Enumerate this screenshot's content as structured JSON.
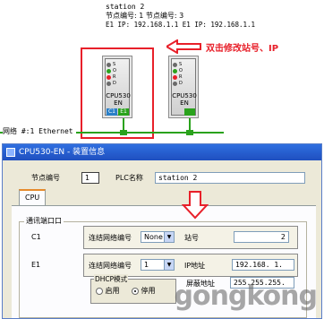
{
  "top_info": {
    "station_line": "station 2",
    "node_line": "节点编号: 1      节点编号: 3",
    "ip_line": "E1 IP: 192.168.1.1 E1 IP: 192.168.1.1"
  },
  "annotation": {
    "text": "双击修改站号、IP",
    "color": "#e8202a"
  },
  "plcs": [
    {
      "model_line1": "CPU530",
      "model_line2": "EN",
      "leds": [
        "S",
        "O",
        "R",
        "D"
      ],
      "ports": [
        "C1",
        "E1"
      ]
    },
    {
      "model_line1": "CPU530",
      "model_line2": "EN",
      "leds": [
        "S",
        "O",
        "R",
        "D"
      ],
      "ports": []
    }
  ],
  "network": {
    "label": "网络 #:1  Ethernet",
    "color": "#2aa21c"
  },
  "dialog": {
    "title": "CPU530-EN - 装置信息",
    "node_label": "节点编号",
    "node_value": "1",
    "plc_name_label": "PLC名称",
    "plc_name_value": "station 2",
    "tab_cpu": "CPU",
    "group_label": "通讯端口口",
    "c1": {
      "port_label": "C1",
      "link_label": "连结网络编号",
      "link_value": "None",
      "station_label": "站号",
      "station_value": "2"
    },
    "e1": {
      "port_label": "E1",
      "link_label": "连结网络编号",
      "link_value": "1",
      "ip_label": "IP地址",
      "ip_value": "192.168.  1.",
      "mask_label": "屏蔽地址",
      "mask_value": "255.255.255.",
      "dhcp_label": "DHCP模式",
      "dhcp_enable": "启用",
      "dhcp_disable": "停用"
    }
  },
  "watermark": "gongkong"
}
